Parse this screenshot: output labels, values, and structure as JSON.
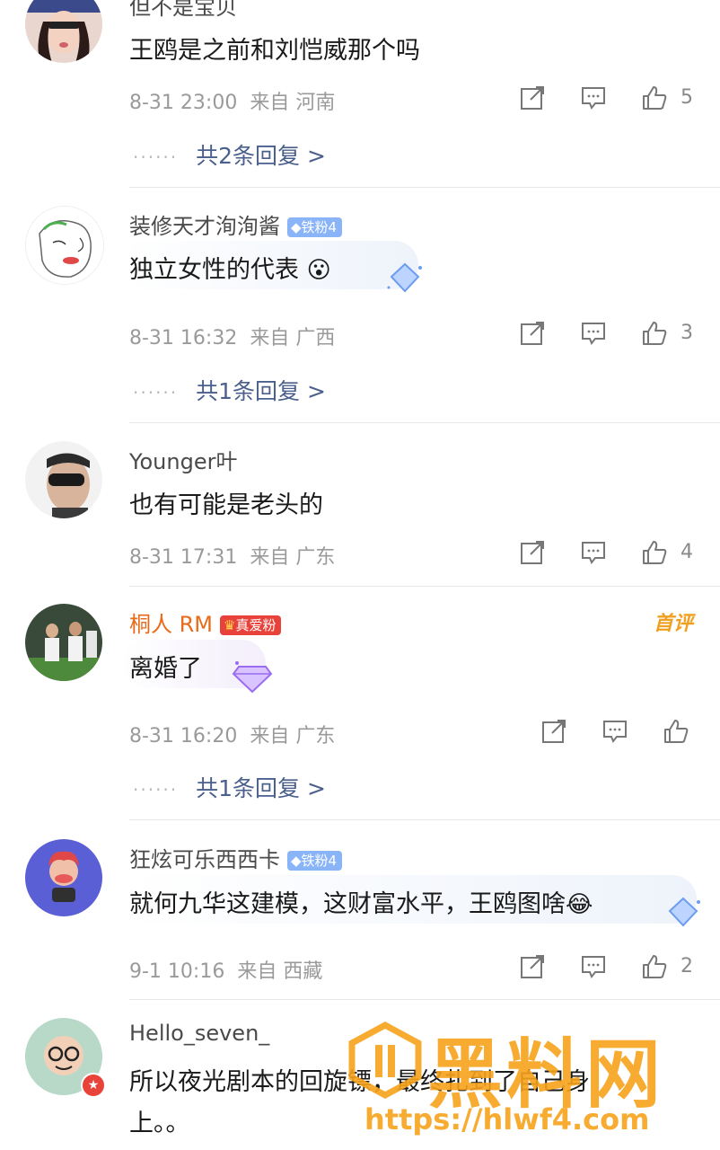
{
  "colors": {
    "accent_reply": "#4a5f8c",
    "orange_name": "#e86a1a",
    "iron_badge": "#8ab4f8",
    "love_badge": "#e8433a",
    "watermark": "#f7a21b"
  },
  "comments": [
    {
      "user": "但不是宝贝",
      "text": "王鸥是之前和刘恺威那个吗",
      "date": "8-31 23:00",
      "from": "来自 河南",
      "likes": "5",
      "replies": "共2条回复 >"
    },
    {
      "user": "装修天才洵洵酱",
      "badge": "铁粉4",
      "text": "独立女性的代表",
      "emoji": "😮",
      "date": "8-31 16:32",
      "from": "来自 广西",
      "likes": "3",
      "replies": "共1条回复 >"
    },
    {
      "user": "Younger叶",
      "text": "也有可能是老头的",
      "date": "8-31 17:31",
      "from": "来自 广东",
      "likes": "4"
    },
    {
      "user": "桐人 RM",
      "badge": "真爱粉",
      "first_label": "首评",
      "text": "离婚了",
      "date": "8-31 16:20",
      "from": "来自 广东",
      "replies": "共1条回复 >"
    },
    {
      "user": "狂炫可乐西西卡",
      "badge": "铁粉4",
      "text": "就何九华这建模，这财富水平，王鸥图啥",
      "emoji": "😂",
      "date": "9-1 10:16",
      "from": "来自 西藏",
      "likes": "2"
    },
    {
      "user": "Hello_seven_",
      "text": "所以夜光剧本的回旋镖，最终扎到了自己身",
      "text2": "上。。"
    }
  ],
  "reply_dots": "······",
  "watermark": {
    "brand": "黑料网",
    "url": "https://hlwf4.com"
  },
  "icons": [
    "share-icon",
    "comment-icon",
    "like-icon"
  ]
}
